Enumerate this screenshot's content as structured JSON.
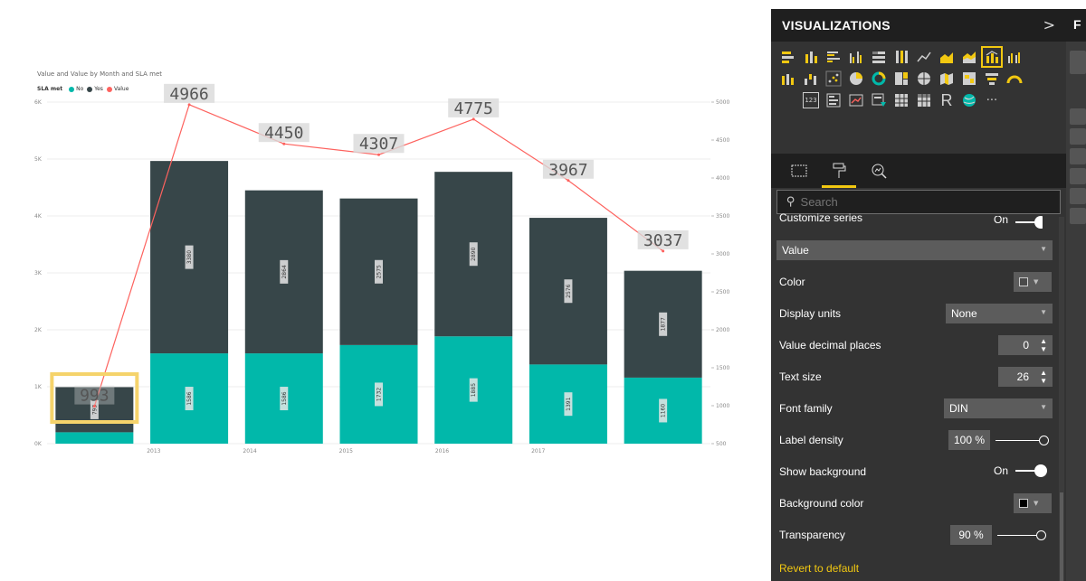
{
  "chart_data": {
    "type": "combo-stacked-bar-line",
    "title": "Value and Value by Month and SLA met",
    "legend": {
      "title": "SLA met",
      "items": [
        {
          "label": "No",
          "color": "#01b8aa"
        },
        {
          "label": "Yes",
          "color": "#374649"
        },
        {
          "label": "Value",
          "color": "#fd625e"
        }
      ],
      "placement": "top-left"
    },
    "x_tick_labels": [
      "2013",
      "2014",
      "2015",
      "2016",
      "2017"
    ],
    "y_left": {
      "range": [
        0,
        6000
      ],
      "ticks": [
        "0K",
        "1K",
        "2K",
        "3K",
        "4K",
        "5K",
        "6K"
      ]
    },
    "y_right": {
      "range": [
        500,
        5000
      ],
      "ticks": [
        "500",
        "1000",
        "1500",
        "2000",
        "2500",
        "3000",
        "3500",
        "4000",
        "4500",
        "5000"
      ]
    },
    "series": [
      {
        "name": "No",
        "color": "#01b8aa",
        "values": [
          200,
          1586,
          1586,
          1732,
          1885,
          1391,
          1160
        ],
        "labels": [
          "",
          "1586",
          "1586",
          "1732",
          "1885",
          "1391",
          "1160"
        ]
      },
      {
        "name": "Yes",
        "color": "#374649",
        "values": [
          793,
          3380,
          2864,
          2575,
          2890,
          2576,
          1877
        ],
        "labels": [
          "793",
          "3380",
          "2864",
          "2575",
          "2890",
          "2576",
          "1877"
        ]
      },
      {
        "name": "Value",
        "color": "#fd625e",
        "axis": "right",
        "values": [
          993,
          4966,
          4450,
          4307,
          4775,
          3967,
          3037
        ],
        "labels": [
          "993",
          "4966",
          "4450",
          "4307",
          "4775",
          "3967",
          "3037"
        ]
      }
    ],
    "grid": true,
    "highlight_color": "#f5d36b"
  },
  "pane": {
    "title": "VISUALIZATIONS",
    "collapse_glyph": ">",
    "next_pane_initial": "F",
    "search_placeholder": "Search",
    "customize_series": {
      "label": "Customize series",
      "state": "On"
    },
    "series_dropdown": "Value",
    "color": {
      "label": "Color",
      "swatch": "#4a4a4a"
    },
    "display_units": {
      "label": "Display units",
      "value": "None"
    },
    "value_decimal_places": {
      "label": "Value decimal places",
      "value": "0"
    },
    "text_size": {
      "label": "Text size",
      "value": "26"
    },
    "font_family": {
      "label": "Font family",
      "value": "DIN"
    },
    "label_density": {
      "label": "Label density",
      "value": "100",
      "unit": "%",
      "level": 1.0
    },
    "show_background": {
      "label": "Show background",
      "state": "On"
    },
    "background_color": {
      "label": "Background color",
      "swatch": "#000000"
    },
    "transparency": {
      "label": "Transparency",
      "value": "90",
      "unit": "%",
      "level": 0.9
    },
    "revert": "Revert to default",
    "more_glyph": "···",
    "r_glyph": "R",
    "badge_123": "123"
  }
}
